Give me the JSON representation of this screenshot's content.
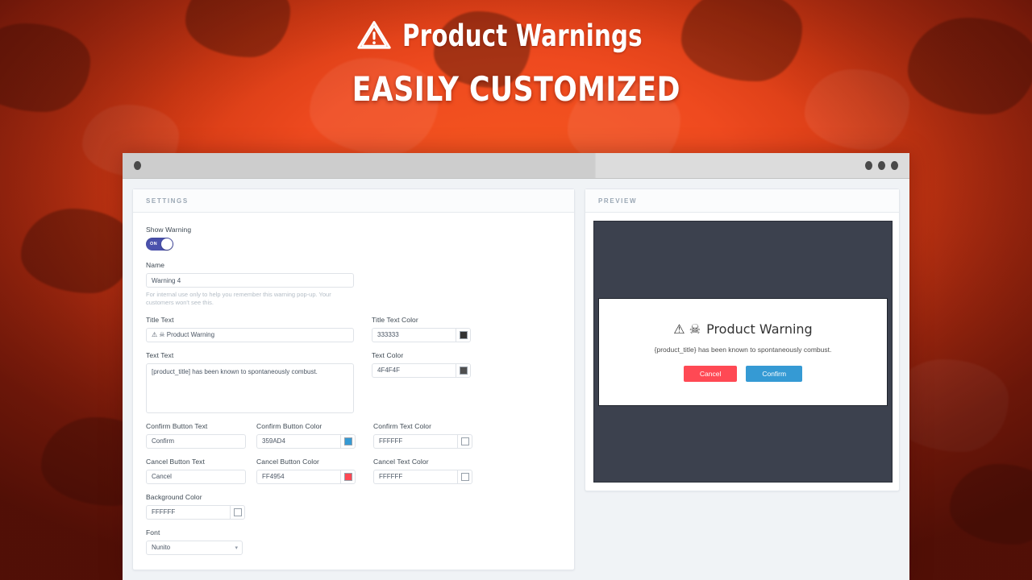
{
  "hero": {
    "icon": "warning-triangle-icon",
    "title": "Product Warnings",
    "subtitle": "EASILY CUSTOMIZED"
  },
  "window": {
    "left_dot": "window-dot",
    "right_dots": 3
  },
  "settings": {
    "header": "SETTINGS",
    "show_warning": {
      "label": "Show Warning",
      "toggle_state": "ON"
    },
    "name": {
      "label": "Name",
      "value": "Warning 4",
      "help": "For internal use only to help you remember this warning pop-up. Your customers won't see this."
    },
    "title_text": {
      "label": "Title Text",
      "value": "⚠ ☠ Product Warning"
    },
    "title_text_color": {
      "label": "Title Text Color",
      "value": "333333",
      "swatch": "#333333"
    },
    "text_text": {
      "label": "Text Text",
      "value": "[product_title] has been known to spontaneously combust."
    },
    "text_color": {
      "label": "Text Color",
      "value": "4F4F4F",
      "swatch": "#4F4F4F"
    },
    "confirm_button_text": {
      "label": "Confirm Button Text",
      "value": "Confirm"
    },
    "confirm_button_color": {
      "label": "Confirm Button Color",
      "value": "359AD4",
      "swatch": "#359AD4"
    },
    "confirm_text_color": {
      "label": "Confirm Text Color",
      "value": "FFFFFF",
      "swatch": "#FFFFFF"
    },
    "cancel_button_text": {
      "label": "Cancel Button Text",
      "value": "Cancel"
    },
    "cancel_button_color": {
      "label": "Cancel Button Color",
      "value": "FF4954",
      "swatch": "#FF4954"
    },
    "cancel_text_color": {
      "label": "Cancel Text Color",
      "value": "FFFFFF",
      "swatch": "#FFFFFF"
    },
    "background_color": {
      "label": "Background Color",
      "value": "FFFFFF",
      "swatch": "#FFFFFF"
    },
    "font": {
      "label": "Font",
      "value": "Nunito",
      "caret": "chevron-down-icon"
    }
  },
  "preview": {
    "header": "PREVIEW",
    "overlay_color": "#3C414E",
    "modal": {
      "title_icons": "⚠ ☠",
      "title": "Product Warning",
      "body": "{product_title} has been known to spontaneously combust.",
      "cancel_label": "Cancel",
      "cancel_color": "#FF4954",
      "confirm_label": "Confirm",
      "confirm_color": "#359AD4",
      "text_color": "#FFFFFF"
    }
  }
}
